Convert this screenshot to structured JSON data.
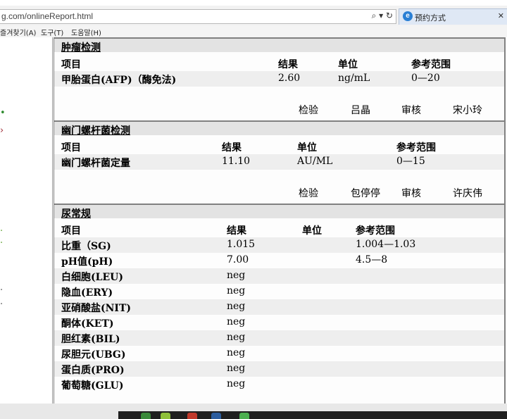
{
  "browser": {
    "url": "g.com/onlineReport.html",
    "tab_label": "预约方式",
    "tab_icon": "ie-icon",
    "url_icons": "⌕ ▾ ↻"
  },
  "menu": {
    "favorites": "즐겨찾기(A)",
    "tools": "도구(T)",
    "help": "도움말(H)"
  },
  "sections": [
    {
      "title": "肿瘤检测",
      "headers": {
        "item": "项目",
        "result": "结果",
        "unit": "单位",
        "range": "参考范围"
      },
      "rows": [
        {
          "name": "甲胎蛋白(AFP)（酶免法)",
          "result": "2.60",
          "unit": "ng/mL",
          "range": "0—20"
        }
      ],
      "sign": {
        "tested_label": "检验",
        "tester": "吕晶",
        "review_label": "审核",
        "reviewer": "宋小玲"
      }
    },
    {
      "title": "幽门螺杆菌检测",
      "headers": {
        "item": "项目",
        "result": "结果",
        "unit": "单位",
        "range": "参考范围"
      },
      "rows": [
        {
          "name": "幽门螺杆菌定量",
          "result": "11.10",
          "unit": "AU/ML",
          "range": "0—15"
        }
      ],
      "sign": {
        "tested_label": "检验",
        "tester": "包停停",
        "review_label": "审核",
        "reviewer": "许庆伟"
      }
    },
    {
      "title": "尿常规",
      "headers": {
        "item": "项目",
        "result": "结果",
        "unit": "单位",
        "range": "参考范围"
      },
      "rows": [
        {
          "name": "比重（SG)",
          "result": "1.015",
          "unit": "",
          "range": "1.004—1.03"
        },
        {
          "name": "pH值(pH)",
          "result": "7.00",
          "unit": "",
          "range": "4.5—8"
        },
        {
          "name": "白细胞(LEU)",
          "result": "neg",
          "unit": "",
          "range": ""
        },
        {
          "name": "隐血(ERY)",
          "result": "neg",
          "unit": "",
          "range": ""
        },
        {
          "name": "亚硝酸盐(NIT)",
          "result": "neg",
          "unit": "",
          "range": ""
        },
        {
          "name": "酮体(KET)",
          "result": "neg",
          "unit": "",
          "range": ""
        },
        {
          "name": "胆红素(BIL)",
          "result": "neg",
          "unit": "",
          "range": ""
        },
        {
          "name": "尿胆元(UBG)",
          "result": "neg",
          "unit": "",
          "range": ""
        },
        {
          "name": "蛋白质(PRO)",
          "result": "neg",
          "unit": "",
          "range": ""
        },
        {
          "name": "葡萄糖(GLU)",
          "result": "neg",
          "unit": "",
          "range": ""
        }
      ]
    }
  ],
  "colors": {
    "section_header_bg": "#e3e3e3",
    "row_shade": "#eeeeee",
    "border": "#808080"
  }
}
